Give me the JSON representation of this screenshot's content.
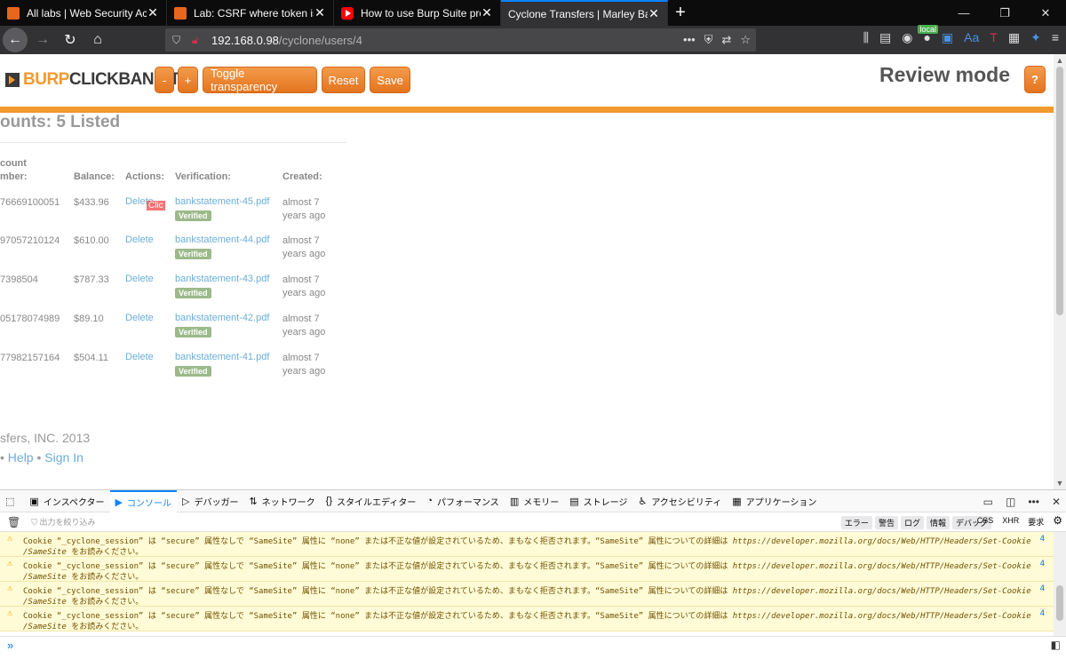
{
  "tabs": [
    {
      "label": "All labs | Web Security Academy",
      "favicon": "burp",
      "active": false
    },
    {
      "label": "Lab: CSRF where token is not tied",
      "favicon": "burp",
      "active": false
    },
    {
      "label": "How to use Burp Suite projects",
      "favicon": "youtube",
      "active": false
    },
    {
      "label": "Cyclone Transfers | Marley Barton",
      "favicon": "none",
      "active": true
    }
  ],
  "nav": {
    "url_host": "192.168.0.98",
    "url_path": "/cyclone/users/4",
    "local_badge": "local"
  },
  "clickbandit": {
    "logo_burp": "BURP",
    "logo_clickbandit": "CLICKBANDIT",
    "minus_label": "-",
    "plus_label": "+",
    "toggle_label": "Toggle transparency",
    "reset_label": "Reset",
    "save_label": "Save",
    "mode_title": "Review mode",
    "help_label": "?",
    "accent_color": "#f29a2e"
  },
  "page": {
    "heading": "ounts: 5 Listed",
    "columns": [
      "count\nmber:",
      "Balance:",
      "Actions:",
      "Verification:",
      "Created:"
    ],
    "rows": [
      {
        "number": "76669100051",
        "balance": "$433.96",
        "action": "Delete",
        "file": "bankstatement-45.pdf",
        "badge": "Verified",
        "created1": "almost 7",
        "created2": "years ago"
      },
      {
        "number": "97057210124",
        "balance": "$610.00",
        "action": "Delete",
        "file": "bankstatement-44.pdf",
        "badge": "Verified",
        "created1": "almost 7",
        "created2": "years ago"
      },
      {
        "number": "7398504",
        "balance": "$787.33",
        "action": "Delete",
        "file": "bankstatement-43.pdf",
        "badge": "Verified",
        "created1": "almost 7",
        "created2": "years ago"
      },
      {
        "number": "05178074989",
        "balance": "$89.10",
        "action": "Delete",
        "file": "bankstatement-42.pdf",
        "badge": "Verified",
        "created1": "almost 7",
        "created2": "years ago"
      },
      {
        "number": "77982157164",
        "balance": "$504.11",
        "action": "Delete",
        "file": "bankstatement-41.pdf",
        "badge": "Verified",
        "created1": "almost 7",
        "created2": "years ago"
      }
    ],
    "click_marker": "Clic",
    "footer_company": "sfers, INC. 2013",
    "footer_bullet": "•",
    "footer_help": "Help",
    "footer_signin": "Sign In"
  },
  "devtools": {
    "tabs": [
      {
        "label": "インスペクター",
        "icon": "inspector-icon"
      },
      {
        "label": "コンソール",
        "icon": "console-icon"
      },
      {
        "label": "デバッガー",
        "icon": "debugger-icon"
      },
      {
        "label": "ネットワーク",
        "icon": "network-icon"
      },
      {
        "label": "スタイルエディター",
        "icon": "style-editor-icon"
      },
      {
        "label": "パフォーマンス",
        "icon": "performance-icon"
      },
      {
        "label": "メモリー",
        "icon": "memory-icon"
      },
      {
        "label": "ストレージ",
        "icon": "storage-icon"
      },
      {
        "label": "アクセシビリティ",
        "icon": "accessibility-icon"
      },
      {
        "label": "アプリケーション",
        "icon": "application-icon"
      }
    ],
    "active_tab": "コンソール",
    "filter_placeholder": "出力を絞り込み",
    "levels": [
      "エラー",
      "警告",
      "ログ",
      "情報",
      "デバッグ"
    ],
    "net_filters": [
      "CSS",
      "XHR",
      "要求"
    ],
    "messages": [
      {
        "line1": "Cookie “_cyclone_session” は “secure” 属性なしで “SameSite” 属性に “none” または不正な値が設定されているため、まもなく拒否されます。“SameSite” 属性についての詳細は ",
        "url": "https://developer.mozilla.org/docs/Web/HTTP/Headers/Set-Cookie",
        "line2_url": "/SameSite",
        "line2": " をお読みください。",
        "count": "4"
      },
      {
        "line1": "Cookie “_cyclone_session” は “secure” 属性なしで “SameSite” 属性に “none” または不正な値が設定されているため、まもなく拒否されます。“SameSite” 属性についての詳細は ",
        "url": "https://developer.mozilla.org/docs/Web/HTTP/Headers/Set-Cookie",
        "line2_url": "/SameSite",
        "line2": " をお読みください。",
        "count": "4"
      },
      {
        "line1": "Cookie “_cyclone_session” は “secure” 属性なしで “SameSite” 属性に “none” または不正な値が設定されているため、まもなく拒否されます。“SameSite” 属性についての詳細は ",
        "url": "https://developer.mozilla.org/docs/Web/HTTP/Headers/Set-Cookie",
        "line2_url": "/SameSite",
        "line2": " をお読みください。",
        "count": "4"
      },
      {
        "line1": "Cookie “_cyclone_session” は “secure” 属性なしで “SameSite” 属性に “none” または不正な値が設定されているため、まもなく拒否されます。“SameSite” 属性についての詳細は ",
        "url": "https://developer.mozilla.org/docs/Web/HTTP/Headers/Set-Cookie",
        "line2_url": "/SameSite",
        "line2": " をお読みください。",
        "count": "4"
      }
    ]
  }
}
